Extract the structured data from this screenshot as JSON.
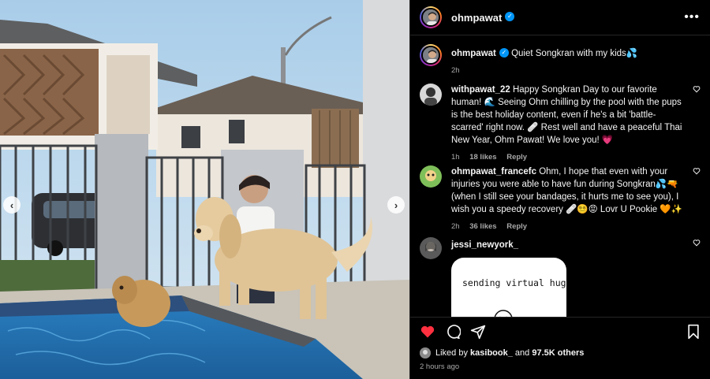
{
  "post": {
    "username": "ohmpawat",
    "more_icon": "more-horizontal-icon"
  },
  "caption": {
    "username": "ohmpawat",
    "text": "Quiet Songkran with my kids💦",
    "time": "2h"
  },
  "comments": [
    {
      "username": "withpawat_22",
      "text": "Happy Songkran Day to our favorite human! 🌊 Seeing Ohm chilling by the pool with the pups is the best holiday content, even if he's a bit 'battle-scarred' right now. 🩹 Rest well and have a peaceful Thai New Year, Ohm Pawat! We love you! 💗",
      "time": "1h",
      "likes": "18 likes",
      "reply": "Reply"
    },
    {
      "username": "ohmpawat_francefc",
      "text": "Ohm, I hope that even with your injuries you were able to have fun during Songkran💦🔫 (when I still see your bandages, it hurts me to see you), I wish you a speedy recovery 🩹😵‍💫😡 Lovr U Pookie 🧡✨",
      "time": "2h",
      "likes": "36 likes",
      "reply": "Reply"
    },
    {
      "username": "jessi_newyork_",
      "sticker_text": "sending virtual hug"
    }
  ],
  "actions": {
    "like_icon": "heart-filled-icon",
    "comment_icon": "comment-icon",
    "share_icon": "send-icon",
    "save_icon": "bookmark-icon",
    "like_color": "#ff3040"
  },
  "likes": {
    "prefix": "Liked by",
    "user": "kasibook_",
    "middle": "and",
    "others": "97.5K others"
  },
  "time_ago": "2 hours ago",
  "colors": {
    "background": "#000000",
    "verified": "#0095f6",
    "secondary_text": "#a8a8a8"
  }
}
